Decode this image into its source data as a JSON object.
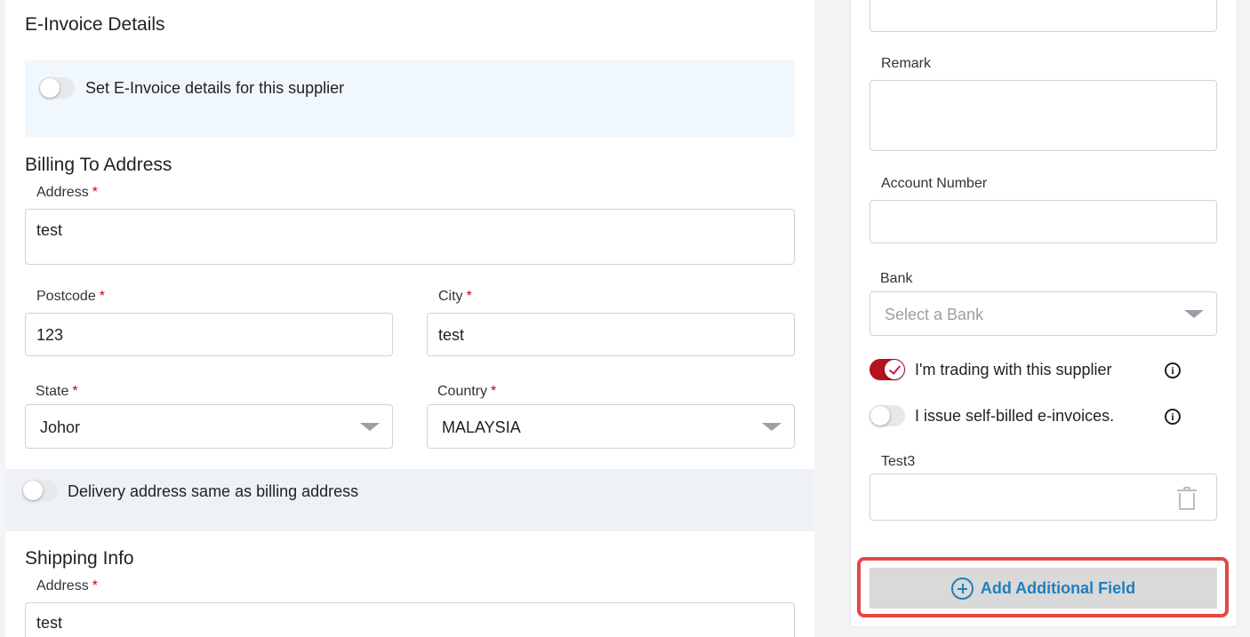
{
  "einvoice": {
    "title": "E-Invoice Details",
    "toggle_label": "Set E-Invoice details for this supplier",
    "toggle_on": false
  },
  "billing": {
    "title": "Billing To Address",
    "address_label": "Address",
    "address_value": "test",
    "postcode_label": "Postcode",
    "postcode_value": "123",
    "city_label": "City",
    "city_value": "test",
    "state_label": "State",
    "state_value": "Johor",
    "country_label": "Country",
    "country_value": "MALAYSIA",
    "required_mark": "*"
  },
  "delivery": {
    "toggle_label": "Delivery address same as billing address",
    "toggle_on": false
  },
  "shipping": {
    "title": "Shipping Info",
    "address_label": "Address",
    "address_value": "test"
  },
  "right": {
    "remark_label": "Remark",
    "remark_value": "",
    "account_label": "Account Number",
    "account_value": "",
    "bank_label": "Bank",
    "bank_placeholder": "Select a Bank",
    "trading_label": "I'm trading with this supplier",
    "trading_on": true,
    "selfbilled_label": "I issue self-billed e-invoices.",
    "selfbilled_on": false,
    "info_glyph": "i",
    "custom_field_label": "Test3",
    "custom_field_value": "",
    "add_field_label": "Add Additional Field"
  },
  "icons": [
    "chevron-down-icon",
    "info-icon",
    "trash-icon",
    "plus-circle-icon"
  ],
  "colors": {
    "accent_blue": "#1f7fbf",
    "toggle_on": "#b3121f",
    "required": "#cc0000",
    "highlight": "#e84545"
  }
}
